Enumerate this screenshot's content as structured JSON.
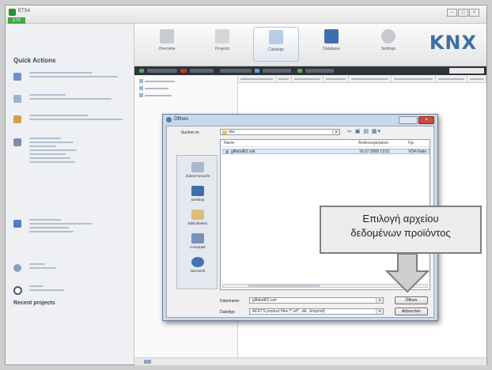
{
  "app": {
    "title": "ETS4",
    "tab": "ETS"
  },
  "window_controls": {
    "min": "–",
    "max": "□",
    "close": "×"
  },
  "sidebar": {
    "quick_actions_title": "Quick Actions",
    "recent_projects_title": "Recent projects"
  },
  "ribbon": {
    "buttons": [
      "Overview",
      "Projects",
      "Catalogs",
      "Database",
      "Settings"
    ],
    "logo": "KNX"
  },
  "dialog": {
    "title": "Öffnen",
    "look_in_label": "Suchen in:",
    "look_in_value": "ske",
    "columns": {
      "name": "Name",
      "date": "Änderungsdatum",
      "type": "Typ"
    },
    "file": {
      "name": "gllfabdl62.ceit",
      "date": "16.07.2009 13:51",
      "type": "VD4-Datei"
    },
    "places": [
      "Zuletzt besucht",
      "Desktop",
      "Bibliotheken",
      "Computer",
      "Netzwerk"
    ],
    "filename_label": "Dateiname:",
    "filename_value": "gllfabdl62.ceit",
    "filetype_label": "Dateityp:",
    "filetype_value": "All ETS product files (*.vd*, .db, .knxprod)",
    "open_button": "Öffnen",
    "cancel_button": "Abbrechen"
  },
  "callout": {
    "line1": "Επιλογή αρχείου",
    "line2": "δεδομένων προϊόντος"
  }
}
